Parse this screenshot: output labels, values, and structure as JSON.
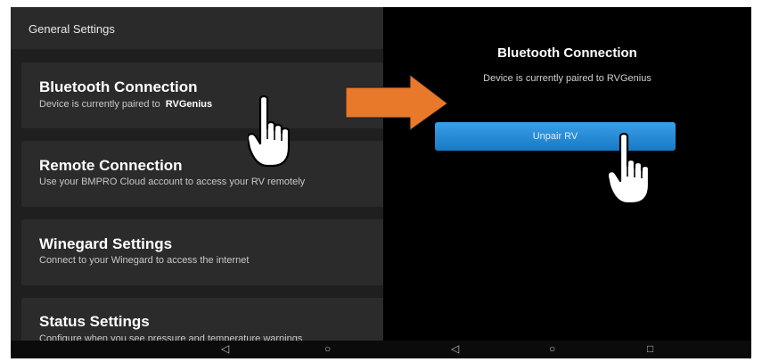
{
  "left_panel": {
    "header": "General Settings",
    "items": [
      {
        "title": "Bluetooth Connection",
        "subtitle": "Device is currently paired to",
        "device": "RVGenius"
      },
      {
        "title": "Remote Connection",
        "subtitle": "Use your BMPRO Cloud account to access your RV remotely"
      },
      {
        "title": "Winegard Settings",
        "subtitle": "Connect to your Winegard to access the internet"
      },
      {
        "title": "Status Settings",
        "subtitle": "Configure when you see pressure and temperature warnings"
      }
    ]
  },
  "right_panel": {
    "title": "Bluetooth Connection",
    "status": "Device is currently paired to RVGenius",
    "unpair_label": "Unpair RV"
  },
  "navbar": {
    "back_icon": "back-triangle-icon",
    "home_icon": "home-circle-icon",
    "recents_icon": "recents-square-icon"
  },
  "colors": {
    "accent": "#2b8fd9",
    "annotation_arrow": "#e8782a"
  }
}
